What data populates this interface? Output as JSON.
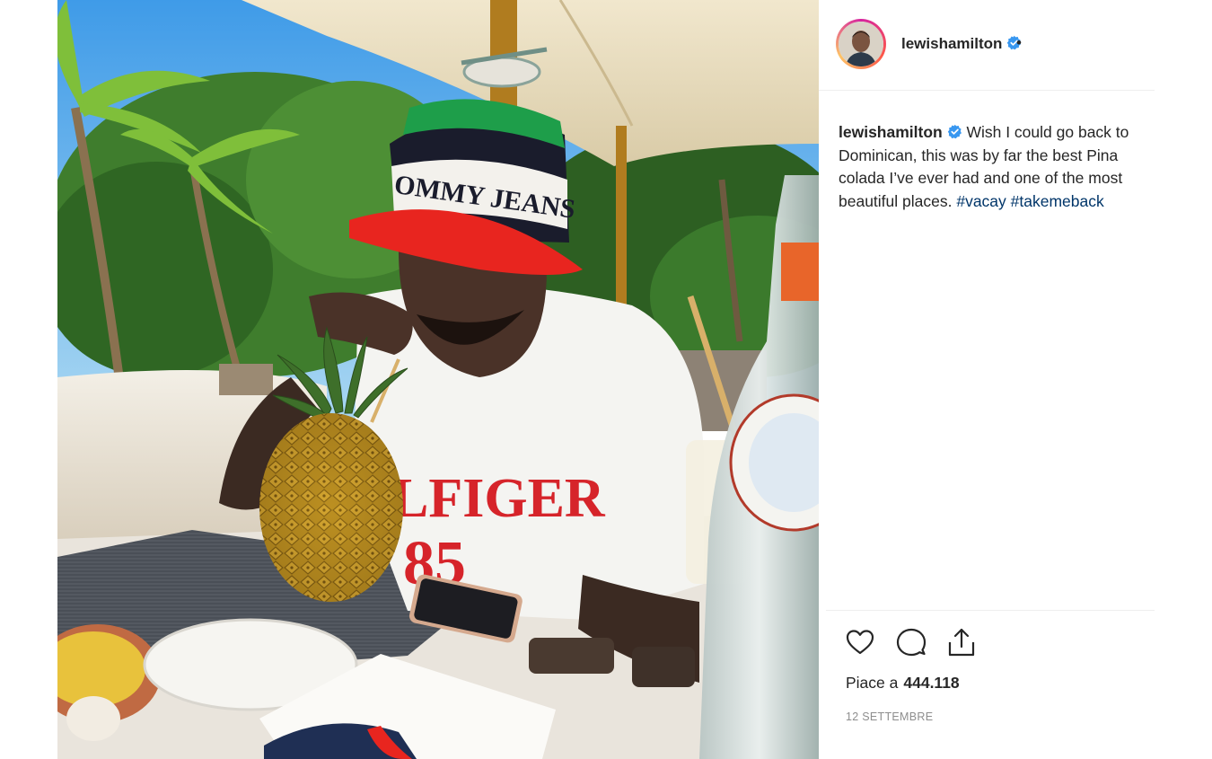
{
  "post": {
    "username": "lewishamilton",
    "header_dot": "•",
    "caption_text": " Wish I could go back to Dominican, this was by far the best Pina colada I’ve ever had and one of the most beautiful places. ",
    "hashtags": [
      "#vacay",
      "#takemeback"
    ],
    "likes_label": "Piace a",
    "likes_count": "444.118",
    "date": "12 SETTEMBRE",
    "photo_text": {
      "hat_text": "OMMY JEANS",
      "shirt_text": "LFIGER",
      "shirt_number": "85"
    }
  },
  "icons": {
    "verified": "verified-badge-icon",
    "like": "heart-icon",
    "comment": "comment-bubble-icon",
    "share": "share-upload-icon"
  },
  "colors": {
    "verified_blue": "#3897f0",
    "hashtag": "#003569",
    "text": "#262626",
    "muted": "#8e8e8e"
  }
}
